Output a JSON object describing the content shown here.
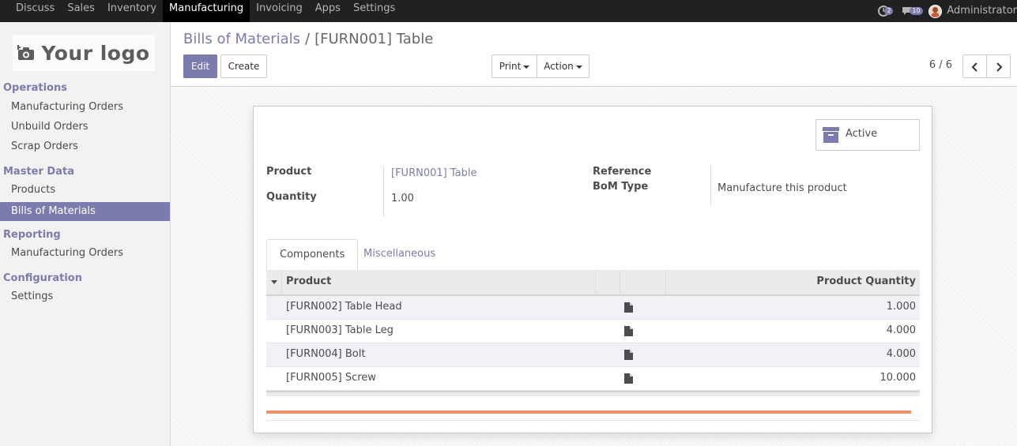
{
  "topbar": {
    "menu": [
      "Discuss",
      "Sales",
      "Inventory",
      "Manufacturing",
      "Invoicing",
      "Apps",
      "Settings"
    ],
    "active_index": 3,
    "activity_count": "2",
    "message_count": "10",
    "user": "Administrator"
  },
  "sidebar": {
    "logo_text": "Your logo",
    "sections": [
      {
        "title": "Operations",
        "items": [
          "Manufacturing Orders",
          "Unbuild Orders",
          "Scrap Orders"
        ]
      },
      {
        "title": "Master Data",
        "items": [
          "Products",
          "Bills of Materials"
        ]
      },
      {
        "title": "Reporting",
        "items": [
          "Manufacturing Orders"
        ]
      },
      {
        "title": "Configuration",
        "items": [
          "Settings"
        ]
      }
    ],
    "active_item": "Bills of Materials"
  },
  "control": {
    "breadcrumb_parent": "Bills of Materials",
    "breadcrumb_separator": "/",
    "breadcrumb_current": "[FURN001] Table",
    "edit_label": "Edit",
    "create_label": "Create",
    "print_label": "Print",
    "action_label": "Action",
    "pager": "6 / 6"
  },
  "form": {
    "active_label": "Active",
    "product_label": "Product",
    "product_value": "[FURN001] Table",
    "quantity_label": "Quantity",
    "quantity_value": "1.00",
    "reference_label": "Reference",
    "reference_value": "",
    "bom_type_label": "BoM Type",
    "bom_type_value": "Manufacture this product",
    "tabs": [
      "Components",
      "Miscellaneous"
    ],
    "table": {
      "headers": {
        "product": "Product",
        "quantity": "Product Quantity"
      },
      "rows": [
        {
          "product": "[FURN002] Table Head",
          "quantity": "1.000"
        },
        {
          "product": "[FURN003] Table Leg",
          "quantity": "4.000"
        },
        {
          "product": "[FURN004] Bolt",
          "quantity": "4.000"
        },
        {
          "product": "[FURN005] Screw",
          "quantity": "10.000"
        }
      ]
    }
  },
  "colors": {
    "accent": "#7c7bad",
    "topbar": "#212121",
    "progress": "#f0906a"
  },
  "icons": [
    "activity-icon",
    "chat-icon",
    "camera-icon",
    "archive-icon",
    "chevron-left-icon",
    "chevron-right-icon",
    "document-icon",
    "sort-caret-icon"
  ]
}
